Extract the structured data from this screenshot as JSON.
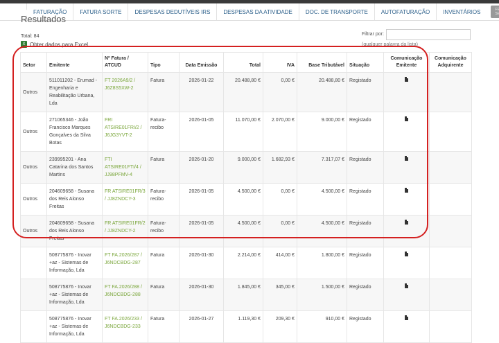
{
  "nav": {
    "items": [
      "FATURAÇÃO",
      "FATURA SORTE",
      "DESPESAS DEDUTÍVEIS IRS",
      "DESPESAS DA ATIVIDADE",
      "DOC. DE TRANSPORTE",
      "AUTOFATURAÇÃO",
      "INVENTÁRIOS"
    ],
    "logout": "FECHAR SESSÃO"
  },
  "heading": "Resultados",
  "total": "Total: 84",
  "export_link": "Obter dados para Excel",
  "filter": {
    "label": "Filtrar por:",
    "value": "",
    "hint": "(qualquer palavra da lista)"
  },
  "table": {
    "headers": [
      "Setor",
      "Emitente",
      "Nº Fatura / ATCUD",
      "Tipo",
      "Data Emissão",
      "Total",
      "IVA",
      "Base Tributável",
      "Situação",
      "Comunicação Emitente",
      "Comunicação Adquirente"
    ],
    "rows": [
      {
        "setor": "Outros",
        "emitente": "511011202 - Erumad - Engenharia e Reabilitação Urbana, Lda",
        "fatura": "FT 2026A9/2 / J6Z8S5XW-2",
        "tipo": "Fatura",
        "data": "2026-01-22",
        "total": "20.488,80 €",
        "iva": "0,00 €",
        "base": "20.488,80 €",
        "situacao": "Registado"
      },
      {
        "setor": "Outros",
        "emitente": "271065346 - João Francisco Marques Gonçalves da Silva Botas",
        "fatura": "FRI ATSIRE01FRI/2 / J6JG3YVT-2",
        "tipo": "Fatura-recibo",
        "data": "2026-01-05",
        "total": "11.070,00 €",
        "iva": "2.070,00 €",
        "base": "9.000,00 €",
        "situacao": "Registado"
      },
      {
        "setor": "Outros",
        "emitente": "239995201 - Ana Catarina dos Santos Martins",
        "fatura": "FTI ATSIRE01FTI/4 / JJ98PFMV-4",
        "tipo": "Fatura",
        "data": "2026-01-20",
        "total": "9.000,00 €",
        "iva": "1.682,93 €",
        "base": "7.317,07 €",
        "situacao": "Registado"
      },
      {
        "setor": "Outros",
        "emitente": "204609658 - Susana dos Reis Alonso Freitas",
        "fatura": "FR ATSIRE01FR/3 / JJ8ZNDCY-3",
        "tipo": "Fatura-recibo",
        "data": "2026-01-05",
        "total": "4.500,00 €",
        "iva": "0,00 €",
        "base": "4.500,00 €",
        "situacao": "Registado"
      },
      {
        "setor": "Outros",
        "emitente": "204609658 - Susana dos Reis Alonso Freitas",
        "fatura": "FR ATSIRE01FR/2 / JJ8ZNDCY-2",
        "tipo": "Fatura-recibo",
        "data": "2026-01-05",
        "total": "4.500,00 €",
        "iva": "0,00 €",
        "base": "4.500,00 €",
        "situacao": "Registado"
      },
      {
        "setor": "",
        "emitente": "508775876 - Inovar +az - Sistemas de Informação, Lda",
        "fatura": "FT FA.2026/287 / J6NDCBDG-287",
        "tipo": "Fatura",
        "data": "2026-01-30",
        "total": "2.214,00 €",
        "iva": "414,00 €",
        "base": "1.800,00 €",
        "situacao": "Registado"
      },
      {
        "setor": "",
        "emitente": "508775876 - Inovar +az - Sistemas de Informação, Lda",
        "fatura": "FT FA.2026/288 / J6NDCBDG-288",
        "tipo": "Fatura",
        "data": "2026-01-30",
        "total": "1.845,00 €",
        "iva": "345,00 €",
        "base": "1.500,00 €",
        "situacao": "Registado"
      },
      {
        "setor": "",
        "emitente": "508775876 - Inovar +az - Sistemas de Informação, Lda",
        "fatura": "FT FA.2026/233 / J6NDCBDG-233",
        "tipo": "Fatura",
        "data": "2026-01-27",
        "total": "1.119,30 €",
        "iva": "209,30 €",
        "base": "910,00 €",
        "situacao": "Registado"
      }
    ]
  },
  "colors": {
    "link": "#7aa63b",
    "nav_text": "#2b5f8a",
    "highlight": "#d42020"
  },
  "icons": {
    "logo": "portal-logo-icon",
    "excel": "excel-icon",
    "document": "document-icon"
  }
}
